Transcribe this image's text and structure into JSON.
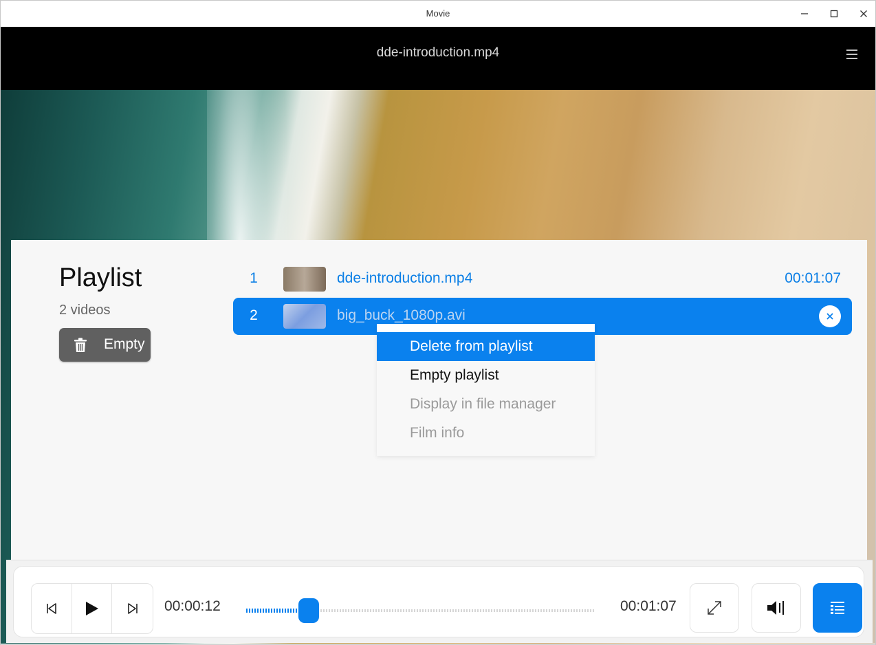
{
  "window": {
    "title": "Movie",
    "controls": [
      "minimize-icon",
      "maximize-icon",
      "close-icon"
    ]
  },
  "video": {
    "title": "dde-introduction.mp4",
    "menu_icon": "hamburger-menu-icon"
  },
  "playlist": {
    "title": "Playlist",
    "count": "2 videos",
    "empty_button_label": "Empty",
    "items": [
      {
        "index": "1",
        "name": "dde-introduction.mp4",
        "duration": "00:01:07"
      },
      {
        "index": "2",
        "name": "big_buck_1080p.avi",
        "duration": ""
      }
    ]
  },
  "context_menu": {
    "items": [
      {
        "label": "Delete from playlist",
        "enabled": true,
        "highlighted": true
      },
      {
        "label": "Empty playlist",
        "enabled": true
      },
      {
        "label": "Display in file manager",
        "enabled": false
      },
      {
        "label": "Film info",
        "enabled": false
      }
    ]
  },
  "controls": {
    "current_time": "00:00:12",
    "total_time": "00:01:07",
    "progress_fraction": 0.179,
    "buttons": [
      "previous-icon",
      "play-icon",
      "next-icon",
      "fullscreen-icon",
      "volume-icon",
      "playlist-icon"
    ]
  },
  "colors": {
    "accent": "#0a81ee",
    "header_bg": "#000000",
    "panel_bg": "#f7f7f7"
  }
}
